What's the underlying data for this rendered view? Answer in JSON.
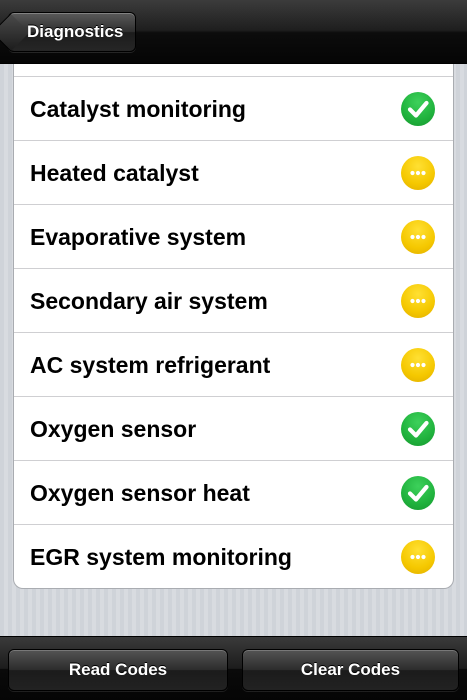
{
  "navbar": {
    "back_label": "Diagnostics"
  },
  "monitors": [
    {
      "label": "Catalyst monitoring",
      "status": "complete",
      "icon": "checkmark-icon",
      "color": "#22b43f"
    },
    {
      "label": "Heated catalyst",
      "status": "pending",
      "icon": "ellipsis-icon",
      "color": "#f5c800"
    },
    {
      "label": "Evaporative system",
      "status": "pending",
      "icon": "ellipsis-icon",
      "color": "#f5c800"
    },
    {
      "label": "Secondary air system",
      "status": "pending",
      "icon": "ellipsis-icon",
      "color": "#f5c800"
    },
    {
      "label": "AC system refrigerant",
      "status": "pending",
      "icon": "ellipsis-icon",
      "color": "#f5c800"
    },
    {
      "label": "Oxygen sensor",
      "status": "complete",
      "icon": "checkmark-icon",
      "color": "#22b43f"
    },
    {
      "label": "Oxygen sensor heat",
      "status": "complete",
      "icon": "checkmark-icon",
      "color": "#22b43f"
    },
    {
      "label": "EGR system monitoring",
      "status": "pending",
      "icon": "ellipsis-icon",
      "color": "#f5c800"
    }
  ],
  "toolbar": {
    "read_label": "Read Codes",
    "clear_label": "Clear Codes"
  }
}
